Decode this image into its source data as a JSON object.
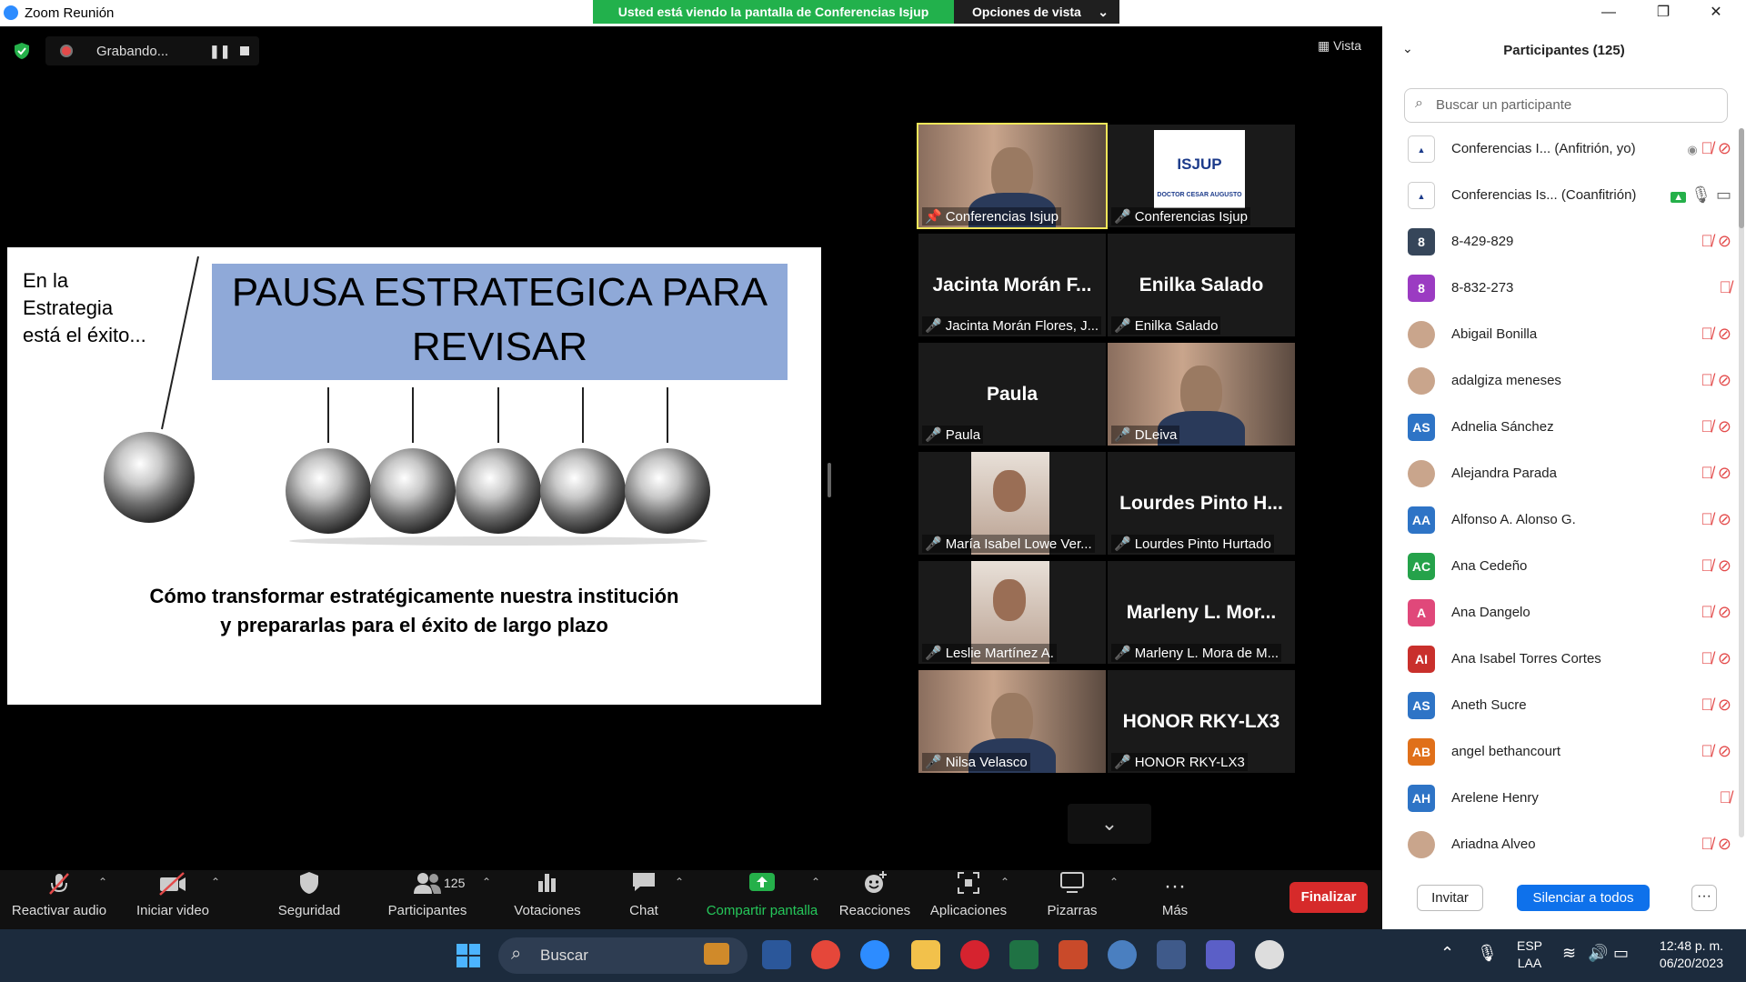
{
  "window": {
    "title": "Zoom Reunión",
    "minimize": "—",
    "restore": "❐",
    "close": "✕"
  },
  "share_banner": {
    "text": "Usted está viendo la pantalla de Conferencias Isjup",
    "view_options": "Opciones de vista",
    "chevron": "⌄"
  },
  "recording": {
    "label": "Grabando...",
    "pause": "❚❚"
  },
  "vista": "Vista",
  "slide": {
    "tagline": "En la\nEstrategia\nestá el éxito...",
    "title": "PAUSA ESTRATEGICA PARA REVISAR",
    "subtitle": "Cómo transformar estratégicamente nuestra institución\ny prepararlas para el éxito de largo plazo"
  },
  "gallery": {
    "tiles": [
      {
        "label": "Conferencias Isjup",
        "center": "",
        "kind": "video-person"
      },
      {
        "label": "Conferencias Isjup",
        "center": "",
        "kind": "logo"
      },
      {
        "label": "Jacinta Morán Flores, J...",
        "center": "Jacinta Morán F...",
        "kind": "name"
      },
      {
        "label": "Enilka Salado",
        "center": "Enilka Salado",
        "kind": "name"
      },
      {
        "label": "Paula",
        "center": "Paula",
        "kind": "name"
      },
      {
        "label": "DLeiva",
        "center": "",
        "kind": "video-person"
      },
      {
        "label": "María Isabel Lowe Ver...",
        "center": "",
        "kind": "video-small"
      },
      {
        "label": "Lourdes Pinto Hurtado",
        "center": "Lourdes Pinto H...",
        "kind": "name"
      },
      {
        "label": "Leslie Martínez A.",
        "center": "",
        "kind": "video-small"
      },
      {
        "label": "Marleny L. Mora de M...",
        "center": "Marleny L. Mor...",
        "kind": "name"
      },
      {
        "label": "Nilsa Velasco",
        "center": "",
        "kind": "video-person"
      },
      {
        "label": "HONOR RKY-LX3",
        "center": "HONOR RKY-LX3",
        "kind": "name"
      }
    ],
    "down_chevron": "⌄",
    "logo_text": "ISJUP",
    "logo_caption": "DOCTOR CESAR AUGUSTO"
  },
  "toolbar": {
    "unmute": "Reactivar audio",
    "start_video": "Iniciar video",
    "security": "Seguridad",
    "participants": "Participantes",
    "participants_count": "125",
    "polls": "Votaciones",
    "chat": "Chat",
    "share": "Compartir pantalla",
    "reactions": "Reacciones",
    "apps": "Aplicaciones",
    "whiteboards": "Pizarras",
    "more": "Más",
    "end": "Finalizar",
    "caret": "⌃"
  },
  "panel": {
    "title": "Participantes (125)",
    "collapse": "⌄",
    "search_placeholder": "Buscar un participante",
    "participants": [
      {
        "name": "Conferencias I... (Anfitrión, yo)",
        "avatar": "",
        "color": "#ffffff",
        "photo": "logo"
      },
      {
        "name": "Conferencias Is... (Coanfitrión)",
        "avatar": "",
        "color": "#ffffff",
        "photo": "logo"
      },
      {
        "name": "8-429-829",
        "avatar": "8",
        "color": "#36465a",
        "photo": ""
      },
      {
        "name": "8-832-273",
        "avatar": "8",
        "color": "#9b3bc2",
        "photo": ""
      },
      {
        "name": "Abigail Bonilla",
        "avatar": "",
        "color": "#c9a58c",
        "photo": "photo"
      },
      {
        "name": "adalgiza meneses",
        "avatar": "",
        "color": "#c9a58c",
        "photo": "photo"
      },
      {
        "name": "Adnelia Sánchez",
        "avatar": "AS",
        "color": "#2e74c6",
        "photo": ""
      },
      {
        "name": "Alejandra Parada",
        "avatar": "",
        "color": "#c9a58c",
        "photo": "photo"
      },
      {
        "name": "Alfonso A. Alonso G.",
        "avatar": "AA",
        "color": "#2e74c6",
        "photo": ""
      },
      {
        "name": "Ana Cedeño",
        "avatar": "AC",
        "color": "#25a24a",
        "photo": ""
      },
      {
        "name": "Ana Dangelo",
        "avatar": "A",
        "color": "#e0487a",
        "photo": ""
      },
      {
        "name": "Ana Isabel Torres Cortes",
        "avatar": "AI",
        "color": "#c9302c",
        "photo": ""
      },
      {
        "name": "Aneth Sucre",
        "avatar": "AS",
        "color": "#2e74c6",
        "photo": ""
      },
      {
        "name": "angel bethancourt",
        "avatar": "AB",
        "color": "#e0701a",
        "photo": ""
      },
      {
        "name": "Arelene Henry",
        "avatar": "AH",
        "color": "#2e74c6",
        "photo": ""
      },
      {
        "name": "Ariadna Alveo",
        "avatar": "",
        "color": "#c9a58c",
        "photo": "photo"
      }
    ],
    "invite": "Invitar",
    "mute_all": "Silenciar a todos",
    "more": "···"
  },
  "taskbar": {
    "search": "Buscar",
    "lang": "ESP\nLAA",
    "time": "12:48 p. m.",
    "date": "06/20/2023"
  }
}
